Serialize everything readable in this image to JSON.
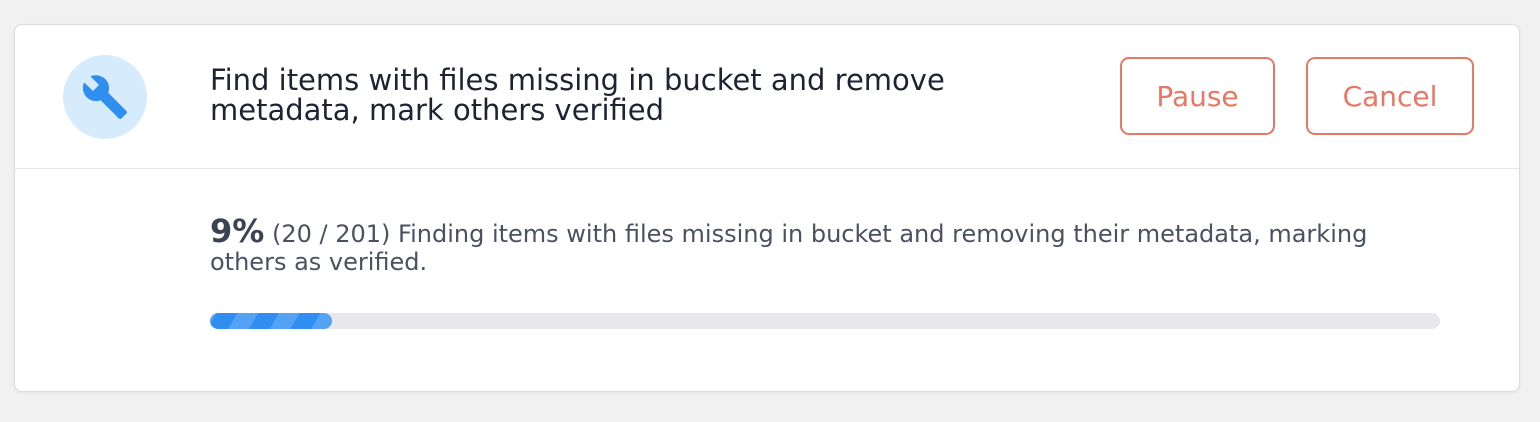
{
  "task": {
    "icon": "wrench-icon",
    "title": "Find items with files missing in bucket and remove metadata, mark others verified"
  },
  "actions": {
    "pause_label": "Pause",
    "cancel_label": "Cancel"
  },
  "progress": {
    "percent_label": "9%",
    "count_label": "(20 / 201)",
    "message": "Finding items with files missing in bucket and removing their metadata, marking others as verified.",
    "completed": 20,
    "total": 201
  },
  "colors": {
    "accent": "#2f8ef0",
    "danger": "#e87764",
    "icon_bg": "#d6ebfc"
  }
}
